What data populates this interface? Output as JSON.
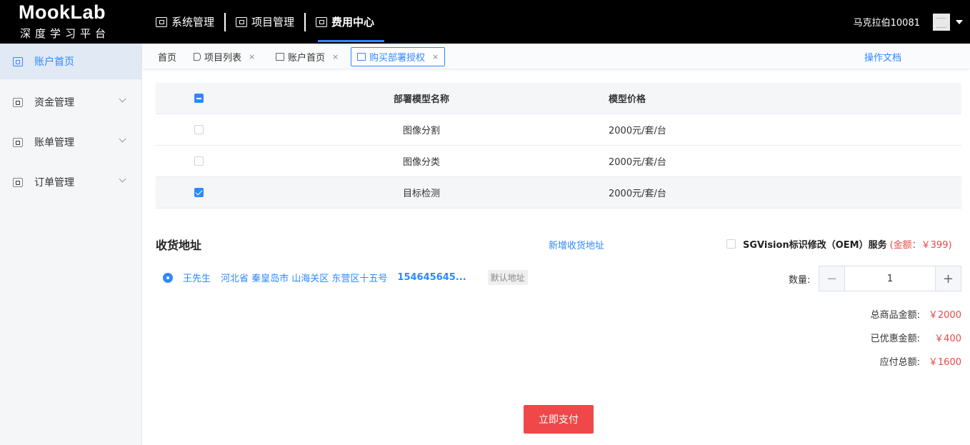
{
  "app": {
    "logo_main": "MookLab",
    "logo_sub": "深度学习平台",
    "nav": [
      {
        "label": "系统管理"
      },
      {
        "label": "项目管理"
      },
      {
        "label": "费用中心"
      }
    ],
    "user_name": "马克拉伯10081"
  },
  "sidebar": {
    "items": [
      {
        "label": "账户首页"
      },
      {
        "label": "资金管理"
      },
      {
        "label": "账单管理"
      },
      {
        "label": "订单管理"
      }
    ]
  },
  "tabs": {
    "items": [
      {
        "label": "首页"
      },
      {
        "label": "项目列表"
      },
      {
        "label": "账户首页"
      },
      {
        "label": "购买部署授权"
      }
    ],
    "close_glyph": "×",
    "doc_link": "操作文档"
  },
  "table": {
    "headers": {
      "name": "部署模型名称",
      "price": "模型价格"
    },
    "rows": [
      {
        "name": "图像分割",
        "price": "2000元/套/台",
        "checked": false
      },
      {
        "name": "图像分类",
        "price": "2000元/套/台",
        "checked": false
      },
      {
        "name": "目标检测",
        "price": "2000元/套/台",
        "checked": true
      }
    ]
  },
  "address": {
    "section_title": "收货地址",
    "add_link": "新增收货地址",
    "entry": {
      "name": "王先生",
      "location": "河北省 秦皇岛市 山海关区 东营区十五号",
      "phone": "154645645...",
      "default_badge": "默认地址"
    }
  },
  "oem": {
    "label": "SGVision标识修改（OEM）服务",
    "price": "(金额：￥399)"
  },
  "quantity": {
    "label": "数量:",
    "value": "1",
    "minus": "−",
    "plus": "+"
  },
  "summary": {
    "total_label": "总商品金额:",
    "total_value": "￥2000",
    "discount_label": "已优惠金额:",
    "discount_value": "￥400",
    "payable_label": "应付总额:",
    "payable_value": "￥1600"
  },
  "pay_button": "立即支付",
  "colors": {
    "accent": "#2f88ff",
    "price_red": "#e84848",
    "pay_button": "#f0474a",
    "topbar": "#000000"
  }
}
